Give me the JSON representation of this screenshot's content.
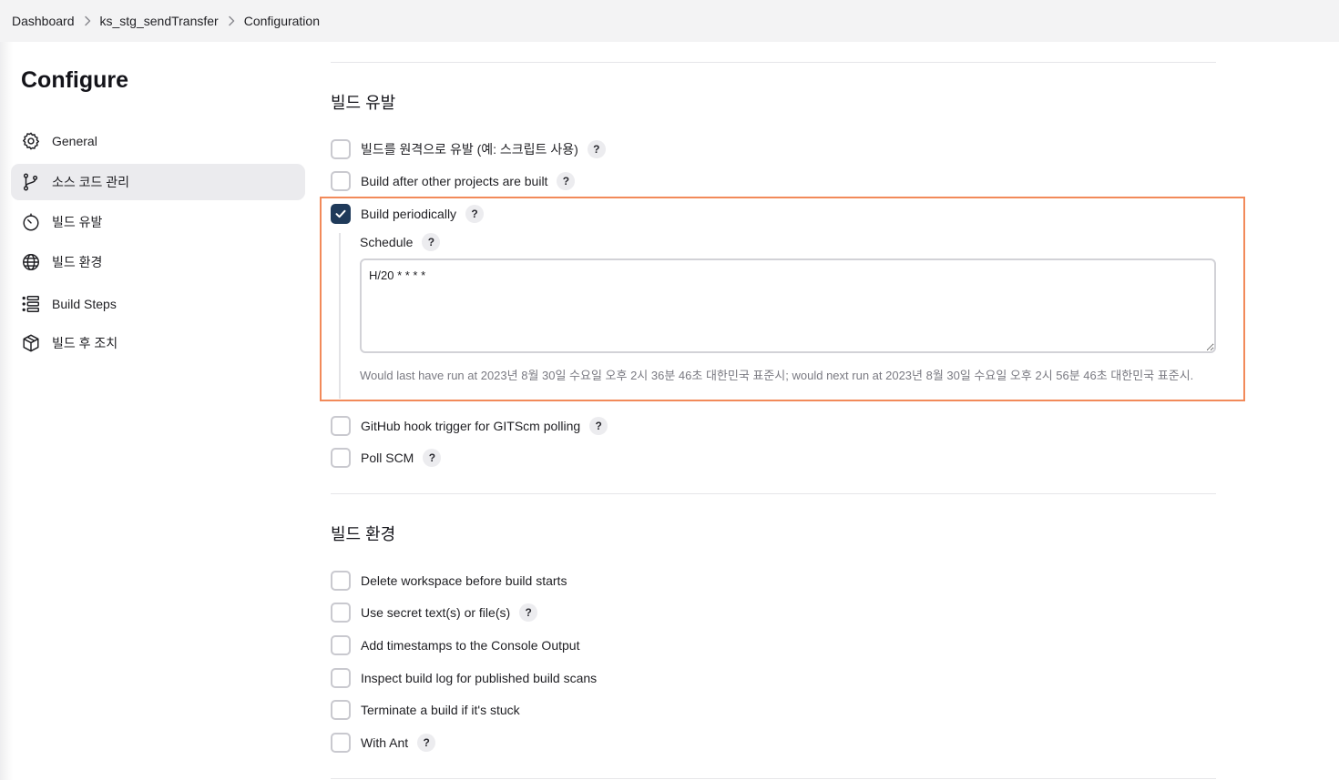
{
  "breadcrumb": [
    "Dashboard",
    "ks_stg_sendTransfer",
    "Configuration"
  ],
  "page_title": "Configure",
  "sidebar": {
    "items": [
      {
        "label": "General",
        "icon": "gear-icon",
        "active": false
      },
      {
        "label": "소스 코드 관리",
        "icon": "branch-icon",
        "active": true
      },
      {
        "label": "빌드 유발",
        "icon": "timer-icon",
        "active": false
      },
      {
        "label": "빌드 환경",
        "icon": "globe-icon",
        "active": false
      },
      {
        "label": "Build Steps",
        "icon": "list-icon",
        "active": false
      },
      {
        "label": "빌드 후 조치",
        "icon": "package-icon",
        "active": false
      }
    ]
  },
  "triggers": {
    "title": "빌드 유발",
    "options": [
      {
        "label": "빌드를 원격으로 유발 (예: 스크립트 사용)",
        "checked": false,
        "help": true
      },
      {
        "label": "Build after other projects are built",
        "checked": false,
        "help": true
      },
      {
        "label": "Build periodically",
        "checked": true,
        "help": true
      },
      {
        "label": "GitHub hook trigger for GITScm polling",
        "checked": false,
        "help": true
      },
      {
        "label": "Poll SCM",
        "checked": false,
        "help": true
      }
    ],
    "schedule": {
      "label": "Schedule",
      "value": "H/20 * * * *",
      "hint": "Would last have run at 2023년 8월 30일 수요일 오후 2시 36분 46초 대한민국 표준시; would next run at 2023년 8월 30일 수요일 오후 2시 56분 46초 대한민국 표준시."
    }
  },
  "build_env": {
    "title": "빌드 환경",
    "options": [
      {
        "label": "Delete workspace before build starts",
        "checked": false,
        "help": false
      },
      {
        "label": "Use secret text(s) or file(s)",
        "checked": false,
        "help": true
      },
      {
        "label": "Add timestamps to the Console Output",
        "checked": false,
        "help": false
      },
      {
        "label": "Inspect build log for published build scans",
        "checked": false,
        "help": false
      },
      {
        "label": "Terminate a build if it's stuck",
        "checked": false,
        "help": false
      },
      {
        "label": "With Ant",
        "checked": false,
        "help": true
      }
    ]
  },
  "help_glyph": "?",
  "highlight_color": "#f28a5a",
  "checkbox_checked_color": "#1f3a5a"
}
